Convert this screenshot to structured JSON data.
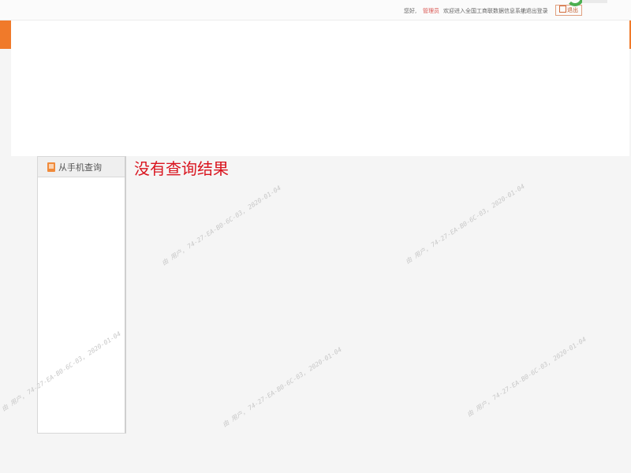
{
  "topbar": {
    "hello": "您好,",
    "user": "管理员",
    "welcome": "欢迎进入全国工商联数据信息系统",
    "quit": "| 退出登录",
    "button_label": "退出"
  },
  "sidebar": {
    "items": [
      {
        "label": "从手机查询"
      }
    ]
  },
  "main": {
    "message": "没有查询结果"
  },
  "watermark": {
    "text": "由 用户, 74-27-EA-B0-6C-03, 2020-01-04"
  },
  "colors": {
    "accent_orange": "#f07a2a",
    "message_red": "#d9141e",
    "ring_green": "#4caf50"
  }
}
